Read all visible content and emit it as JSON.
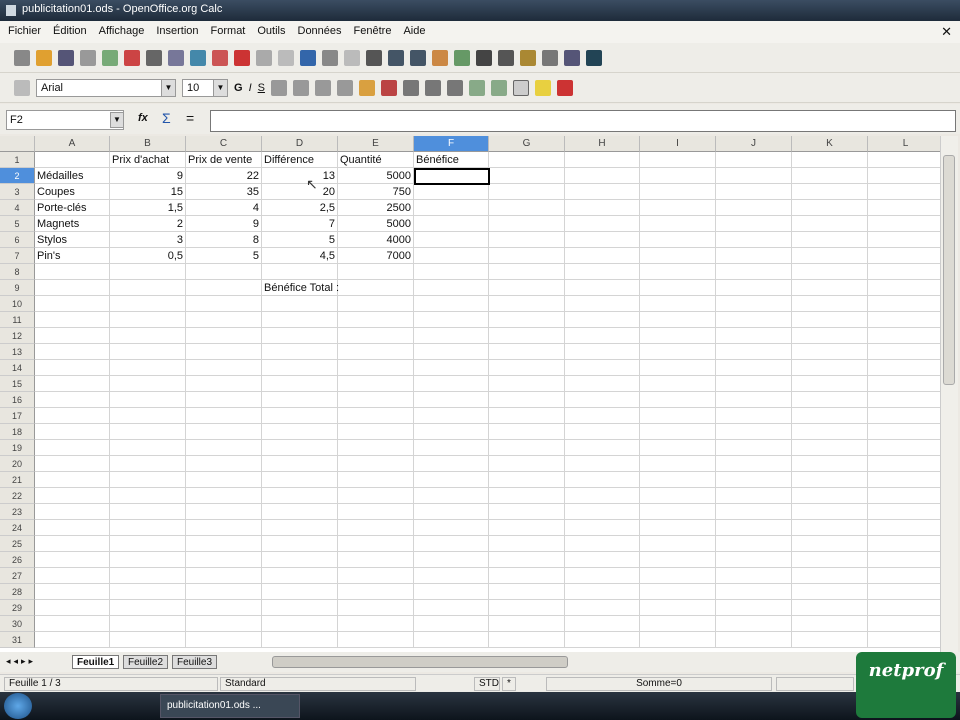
{
  "window": {
    "title": "publicitation01.ods - OpenOffice.org Calc",
    "close": "✕"
  },
  "menu": [
    "Fichier",
    "Édition",
    "Affichage",
    "Insertion",
    "Format",
    "Outils",
    "Données",
    "Fenêtre",
    "Aide"
  ],
  "toolbar": {
    "font": "Arial",
    "size": "10",
    "bold": "G",
    "italic": "I",
    "underline": "S"
  },
  "formula_bar": {
    "cell_ref": "F2",
    "fx": "fx",
    "sum": "Σ",
    "equals": "=",
    "value": ""
  },
  "columns": [
    "A",
    "B",
    "C",
    "D",
    "E",
    "F",
    "G",
    "H",
    "I",
    "J",
    "K",
    "L"
  ],
  "selected_column": "F",
  "row_count": 31,
  "selected_row": 2,
  "cells": [
    {
      "r": 1,
      "c": 1,
      "v": "Prix d'achat"
    },
    {
      "r": 1,
      "c": 2,
      "v": "Prix de vente"
    },
    {
      "r": 1,
      "c": 3,
      "v": "Différence"
    },
    {
      "r": 1,
      "c": 4,
      "v": "Quantité"
    },
    {
      "r": 1,
      "c": 5,
      "v": "Bénéfice"
    },
    {
      "r": 2,
      "c": 0,
      "v": "Médailles"
    },
    {
      "r": 2,
      "c": 1,
      "v": "9",
      "n": 1
    },
    {
      "r": 2,
      "c": 2,
      "v": "22",
      "n": 1
    },
    {
      "r": 2,
      "c": 3,
      "v": "13",
      "n": 1
    },
    {
      "r": 2,
      "c": 4,
      "v": "5000",
      "n": 1
    },
    {
      "r": 3,
      "c": 0,
      "v": "Coupes"
    },
    {
      "r": 3,
      "c": 1,
      "v": "15",
      "n": 1
    },
    {
      "r": 3,
      "c": 2,
      "v": "35",
      "n": 1
    },
    {
      "r": 3,
      "c": 3,
      "v": "20",
      "n": 1
    },
    {
      "r": 3,
      "c": 4,
      "v": "750",
      "n": 1
    },
    {
      "r": 4,
      "c": 0,
      "v": "Porte-clés"
    },
    {
      "r": 4,
      "c": 1,
      "v": "1,5",
      "n": 1
    },
    {
      "r": 4,
      "c": 2,
      "v": "4",
      "n": 1
    },
    {
      "r": 4,
      "c": 3,
      "v": "2,5",
      "n": 1
    },
    {
      "r": 4,
      "c": 4,
      "v": "2500",
      "n": 1
    },
    {
      "r": 5,
      "c": 0,
      "v": "Magnets"
    },
    {
      "r": 5,
      "c": 1,
      "v": "2",
      "n": 1
    },
    {
      "r": 5,
      "c": 2,
      "v": "9",
      "n": 1
    },
    {
      "r": 5,
      "c": 3,
      "v": "7",
      "n": 1
    },
    {
      "r": 5,
      "c": 4,
      "v": "5000",
      "n": 1
    },
    {
      "r": 6,
      "c": 0,
      "v": "Stylos"
    },
    {
      "r": 6,
      "c": 1,
      "v": "3",
      "n": 1
    },
    {
      "r": 6,
      "c": 2,
      "v": "8",
      "n": 1
    },
    {
      "r": 6,
      "c": 3,
      "v": "5",
      "n": 1
    },
    {
      "r": 6,
      "c": 4,
      "v": "4000",
      "n": 1
    },
    {
      "r": 7,
      "c": 0,
      "v": "Pin's"
    },
    {
      "r": 7,
      "c": 1,
      "v": "0,5",
      "n": 1
    },
    {
      "r": 7,
      "c": 2,
      "v": "5",
      "n": 1
    },
    {
      "r": 7,
      "c": 3,
      "v": "4,5",
      "n": 1
    },
    {
      "r": 7,
      "c": 4,
      "v": "7000",
      "n": 1
    },
    {
      "r": 9,
      "c": 3,
      "v": "Bénéfice Total :"
    }
  ],
  "sheet_tabs": [
    "Feuille1",
    "Feuille2",
    "Feuille3"
  ],
  "status": {
    "sheet": "Feuille 1 / 3",
    "style": "Standard",
    "mode": "STD",
    "modified": "*",
    "sum": "Somme=0"
  },
  "taskbar": {
    "window": "publicitation01.ods ..."
  },
  "logo": "netprof"
}
